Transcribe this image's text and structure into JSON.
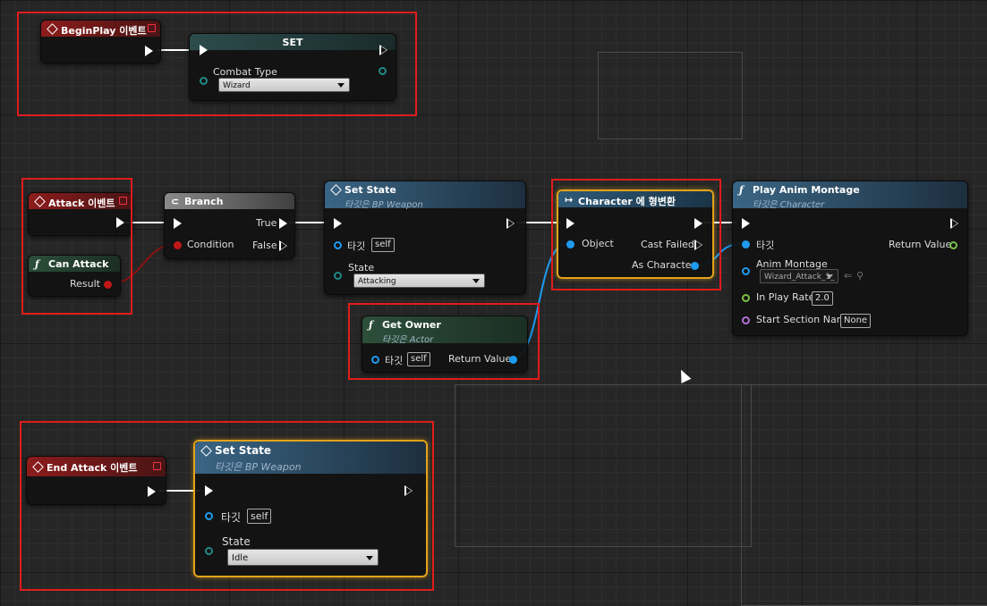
{
  "begin_play": {
    "title": "BeginPlay 이벤트"
  },
  "set_node": {
    "title": "SET",
    "pin_label": "Combat Type",
    "value": "Wizard"
  },
  "attack_event": {
    "title": "Attack 이벤트"
  },
  "can_attack": {
    "title": "Can Attack",
    "pin_result": "Result"
  },
  "branch": {
    "title": "Branch",
    "pin_condition": "Condition",
    "pin_true": "True",
    "pin_false": "False"
  },
  "set_state1": {
    "title": "Set State",
    "subtitle": "타깃은 BP Weapon",
    "pin_target": "타깃",
    "target_value": "self",
    "pin_state": "State",
    "state_value": "Attacking"
  },
  "cast": {
    "title": "Character 에 형변환",
    "pin_object": "Object",
    "pin_cast_failed": "Cast Failed",
    "pin_as_character": "As Character"
  },
  "play_anim": {
    "title": "Play Anim Montage",
    "subtitle": "타깃은 Character",
    "pin_target": "타깃",
    "pin_return": "Return Value",
    "pin_montage": "Anim Montage",
    "montage_value": "Wizard_Attack_1_",
    "pin_rate": "In Play Rate",
    "rate_value": "2.0",
    "pin_section": "Start Section Name",
    "section_value": "None"
  },
  "get_owner": {
    "title": "Get Owner",
    "subtitle": "타깃은 Actor",
    "pin_target": "타깃",
    "target_value": "self",
    "pin_return": "Return Value"
  },
  "end_attack": {
    "title": "End Attack 이벤트"
  },
  "set_state2": {
    "title": "Set State",
    "subtitle": "타깃은 BP Weapon",
    "pin_target": "타깃",
    "target_value": "self",
    "pin_state": "State",
    "state_value": "Idle"
  },
  "colors": {
    "exec": "#ffffff",
    "object_pin": "#1d9bf0",
    "bool_pin": "#c01818",
    "float_pin": "#7ac046",
    "name_pin": "#b470d8",
    "enum_pin": "#1f8a86",
    "selection": "#e3a21a",
    "highlight_box": "#e01c1c"
  }
}
